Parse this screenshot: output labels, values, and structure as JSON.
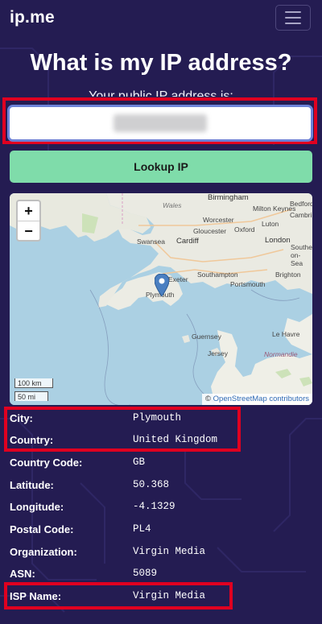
{
  "brand": "ip.me",
  "title": "What is my IP address?",
  "subtitle": "Your public IP address is:",
  "lookup_label": "Lookup IP",
  "map": {
    "zoom_in": "+",
    "zoom_out": "−",
    "scale_km": "100 km",
    "scale_mi": "50 mi",
    "attribution_prefix": "©",
    "attribution_link": "OpenStreetMap contributors",
    "places": {
      "birmingham": "Birmingham",
      "milton_keynes": "Milton Keynes",
      "cambridge": "Cambri",
      "bedford": "Bedford",
      "wales": "Wales",
      "worcester": "Worcester",
      "luton": "Luton",
      "gloucester": "Gloucester",
      "oxford": "Oxford",
      "swansea": "Swansea",
      "cardiff": "Cardiff",
      "london": "London",
      "southend": "Southend-on-Sea",
      "exeter": "Exeter",
      "southampton": "Southampton",
      "brighton": "Brighton",
      "plymouth": "Plymouth",
      "portsmouth": "Portsmouth",
      "guernsey": "Guernsey",
      "jersey": "Jersey",
      "le_havre": "Le Havre",
      "normandie": "Normandie"
    }
  },
  "details": [
    {
      "label": "City:",
      "value": "Plymouth"
    },
    {
      "label": "Country:",
      "value": "United Kingdom"
    },
    {
      "label": "Country Code:",
      "value": "GB"
    },
    {
      "label": "Latitude:",
      "value": "50.368"
    },
    {
      "label": "Longitude:",
      "value": "-4.1329"
    },
    {
      "label": "Postal Code:",
      "value": "PL4"
    },
    {
      "label": "Organization:",
      "value": "Virgin Media"
    },
    {
      "label": "ASN:",
      "value": "5089"
    },
    {
      "label": "ISP Name:",
      "value": "Virgin Media"
    }
  ],
  "colors": {
    "background": "#241c52",
    "accent_button": "#7fdcaa",
    "highlight": "#e00020"
  }
}
